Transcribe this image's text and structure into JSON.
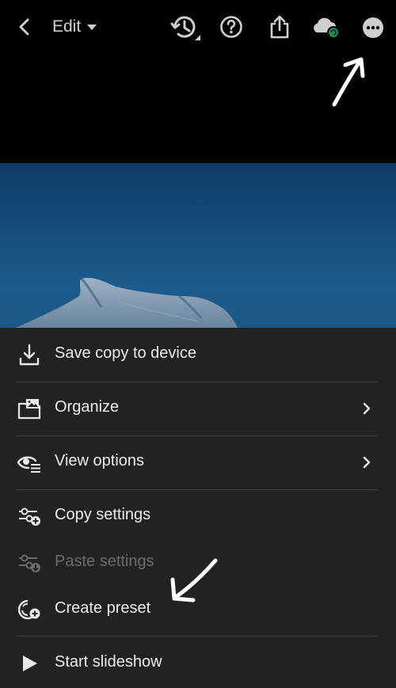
{
  "header": {
    "mode_label": "Edit"
  },
  "menu": {
    "items": [
      {
        "label": "Save copy to device",
        "icon": "download-icon"
      },
      {
        "label": "Organize",
        "icon": "folder-photo-icon",
        "has_submenu": true
      },
      {
        "label": "View options",
        "icon": "eye-options-icon",
        "has_submenu": true
      },
      {
        "label": "Copy settings",
        "icon": "copy-settings-icon"
      },
      {
        "label": "Paste settings",
        "icon": "paste-settings-icon",
        "disabled": true
      },
      {
        "label": "Create preset",
        "icon": "create-preset-icon"
      },
      {
        "label": "Start slideshow",
        "icon": "play-icon"
      }
    ]
  },
  "colors": {
    "menu_background": "#222222",
    "photo_water": "#174f80",
    "sync_badge": "#1f8a55"
  }
}
